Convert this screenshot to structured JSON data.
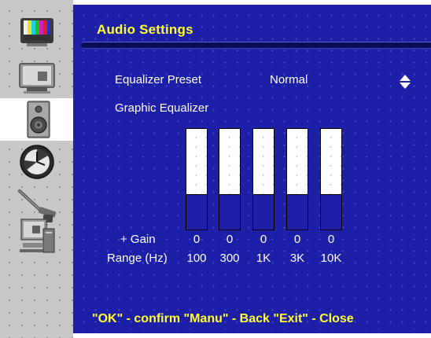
{
  "window": {
    "title": "Audio Settings"
  },
  "sidebar": {
    "items": [
      {
        "name": "picture",
        "icon": "tv-test-pattern-icon",
        "active": false
      },
      {
        "name": "screen",
        "icon": "monitor-screen-icon",
        "active": false
      },
      {
        "name": "audio",
        "icon": "speaker-icon",
        "active": true
      },
      {
        "name": "clock",
        "icon": "clock-icon",
        "active": false
      },
      {
        "name": "tools",
        "icon": "wrench-icon",
        "active": false
      },
      {
        "name": "computer",
        "icon": "computer-icon",
        "active": false
      }
    ]
  },
  "preset": {
    "label": "Equalizer Preset",
    "value": "Normal",
    "icon": "up-down-arrows-icon"
  },
  "equalizer": {
    "label": "Graphic Equalizer",
    "gain_label": "+ Gain",
    "range_label": "Range (Hz)",
    "bands": [
      {
        "range": "100",
        "gain": "0",
        "level": 0.66
      },
      {
        "range": "300",
        "gain": "0",
        "level": 0.66
      },
      {
        "range": "1K",
        "gain": "0",
        "level": 0.66
      },
      {
        "range": "3K",
        "gain": "0",
        "level": 0.66
      },
      {
        "range": "10K",
        "gain": "0",
        "level": 0.66
      }
    ]
  },
  "footer": {
    "hint": "\"OK\" - confirm \"Manu\" - Back \"Exit\" - Close"
  },
  "colors": {
    "panel": "#1d1fa6",
    "title": "#ffff33",
    "text": "#ffffff",
    "rail": "#c7c7c7"
  }
}
